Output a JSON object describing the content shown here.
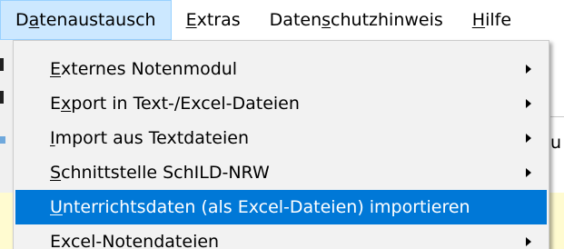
{
  "menubar": {
    "items": [
      {
        "label_pre": "D",
        "label_u": "a",
        "label_post": "tenaustausch"
      },
      {
        "label_pre": "",
        "label_u": "E",
        "label_post": "xtras"
      },
      {
        "label_pre": "Daten",
        "label_u": "s",
        "label_post": "chutzhinweis"
      },
      {
        "label_pre": "",
        "label_u": "H",
        "label_post": "ilfe"
      }
    ]
  },
  "dropdown": {
    "items": [
      {
        "label_pre": "",
        "label_u": "E",
        "label_post": "xternes Notenmodul",
        "submenu_icon": "chevron-right-icon"
      },
      {
        "label_pre": "E",
        "label_u": "x",
        "label_post": "port in Text-/Excel-Dateien",
        "submenu_icon": "chevron-right-icon"
      },
      {
        "label_pre": "",
        "label_u": "I",
        "label_post": "mport aus Textdateien",
        "submenu_icon": "chevron-right-icon"
      },
      {
        "label_pre": "",
        "label_u": "S",
        "label_post": "chnittstelle SchILD-NRW",
        "submenu_icon": "chevron-right-icon"
      },
      {
        "label_pre": "",
        "label_u": "U",
        "label_post": "nterrichtsdaten (als Excel-Dateien) importieren"
      },
      {
        "label_pre": "E",
        "label_u": "x",
        "label_post": "cel-Notendateien",
        "submenu_icon": "chevron-right-icon"
      }
    ]
  },
  "background": {
    "right_text": "u"
  },
  "colors": {
    "menubar_active_bg": "#cce8ff",
    "selected_item_bg": "#0078d7",
    "dropdown_bg": "#f2f2f2",
    "highlight_row_bg": "#fffbd0"
  }
}
